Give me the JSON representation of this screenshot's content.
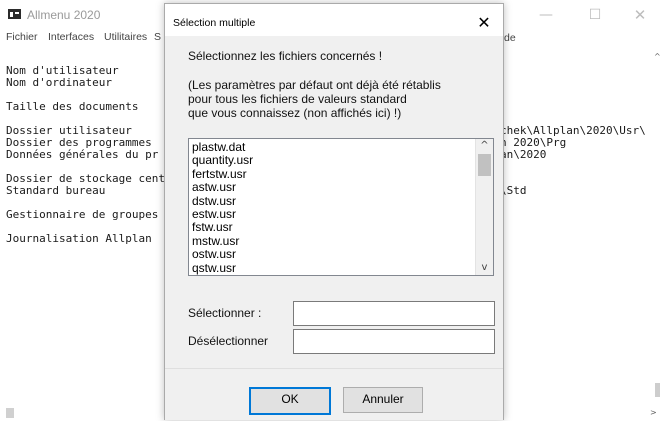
{
  "app": {
    "title": "Allmenu 2020",
    "menu": [
      "Fichier",
      "Interfaces",
      "Utilitaires",
      "S",
      "de"
    ],
    "window_controls": {
      "minimize": "—",
      "maximize": "☐",
      "close": "✕"
    },
    "left_lines": [
      "Nom d'utilisateur",
      "Nom d'ordinateur",
      "",
      "Taille des documents",
      "",
      "Dossier utilisateur",
      "Dossier des programmes",
      "Données générales du pr",
      "",
      "Dossier de stockage cent",
      "Standard bureau",
      "",
      "Gestionnaire de groupes",
      "",
      "Journalisation Allplan"
    ],
    "right_lines": [
      "chek\\Allplan\\2020\\Usr\\",
      "n 2020\\Prg",
      "an\\2020",
      "",
      "",
      "\\Std"
    ]
  },
  "dialog": {
    "title": "Sélection multiple",
    "close_label": "✕",
    "prompt": "Sélectionnez les fichiers concernés !",
    "note_lines": [
      "(Les paramètres par défaut ont déjà été rétablis",
      "pour tous les fichiers de valeurs standard",
      "que vous connaissez (non affichés ici) !)"
    ],
    "files": [
      "plastw.dat",
      "quantity.usr",
      "fertstw.usr",
      "astw.usr",
      "dstw.usr",
      "estw.usr",
      "fstw.usr",
      "mstw.usr",
      "ostw.usr",
      "qstw.usr"
    ],
    "select_label": "Sélectionner :",
    "select_value": "",
    "deselect_label": "Désélectionner",
    "deselect_value": "",
    "ok_label": "OK",
    "cancel_label": "Annuler"
  }
}
